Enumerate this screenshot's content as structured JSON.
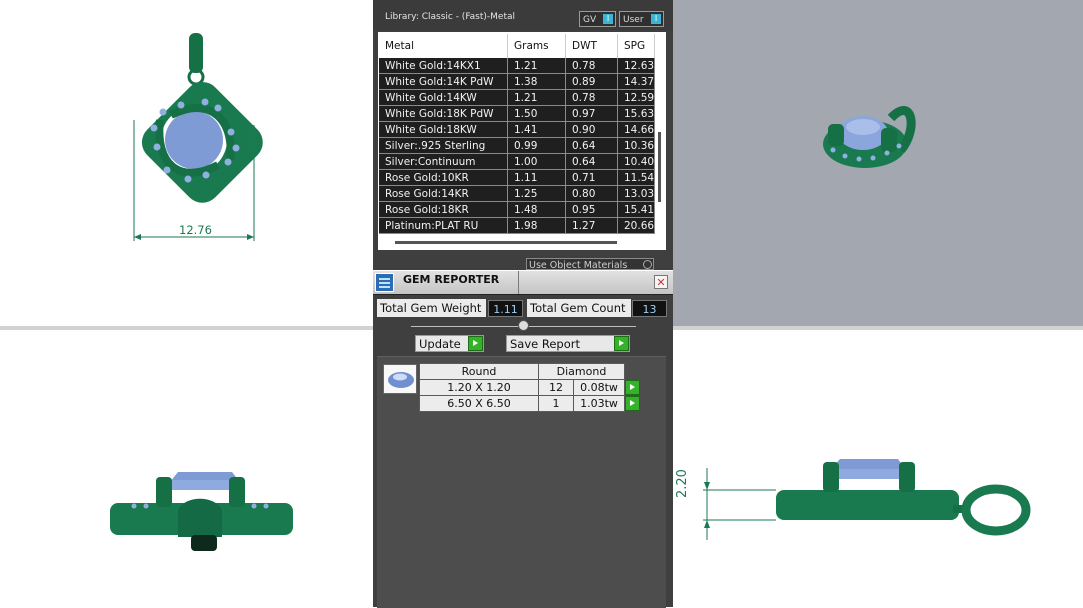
{
  "library": {
    "title": "Library: Classic - (Fast)-Metal",
    "toggle_gv": "GV",
    "toggle_user": "User",
    "toggle_icon": "I",
    "columns": [
      "Metal",
      "Grams",
      "DWT",
      "SPG"
    ],
    "rows": [
      [
        "White Gold:14KX1",
        "1.21",
        "0.78",
        "12.63"
      ],
      [
        "White Gold:14K PdW",
        "1.38",
        "0.89",
        "14.37"
      ],
      [
        "White Gold:14KW",
        "1.21",
        "0.78",
        "12.59"
      ],
      [
        "White Gold:18K PdW",
        "1.50",
        "0.97",
        "15.63"
      ],
      [
        "White Gold:18KW",
        "1.41",
        "0.90",
        "14.66"
      ],
      [
        "Silver:.925 Sterling",
        "0.99",
        "0.64",
        "10.36"
      ],
      [
        "Silver:Continuum",
        "1.00",
        "0.64",
        "10.40"
      ],
      [
        "Rose Gold:10KR",
        "1.11",
        "0.71",
        "11.54"
      ],
      [
        "Rose Gold:14KR",
        "1.25",
        "0.80",
        "13.03"
      ],
      [
        "Rose Gold:18KR",
        "1.48",
        "0.95",
        "15.41"
      ],
      [
        "Platinum:PLAT RU",
        "1.98",
        "1.27",
        "20.66"
      ]
    ],
    "use_object_materials": "Use Object Materials"
  },
  "gem_reporter": {
    "title": "GEM REPORTER",
    "total_weight_label": "Total Gem Weight",
    "total_weight": "1.11",
    "total_count_label": "Total Gem Count",
    "total_count": "13",
    "update_label": "Update",
    "save_report_label": "Save Report",
    "shape": "Round",
    "material": "Diamond",
    "gems": [
      {
        "size": "1.20 X 1.20",
        "count": "12",
        "weight": "0.08tw"
      },
      {
        "size": "6.50 X 6.50",
        "count": "1",
        "weight": "1.03tw"
      }
    ]
  },
  "viewports": {
    "top_dimension": "12.76",
    "side_dimension": "2.20"
  },
  "colors": {
    "metal_green": "#1a7a53",
    "gem_blue": "#7f9bd6",
    "accent_cyan": "#3bb6d2",
    "go_green": "#34b32a"
  },
  "icons": [
    "gem-reporter-icon",
    "close-icon",
    "play-arrow-icon",
    "slider-knob"
  ]
}
